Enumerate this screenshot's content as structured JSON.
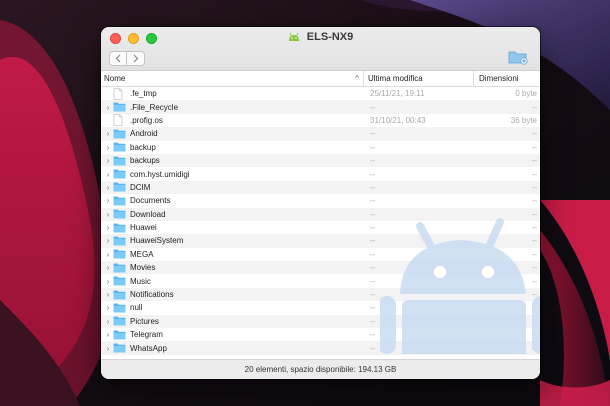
{
  "window": {
    "title": "ELS-NX9",
    "title_icon": "android-icon"
  },
  "toolbar": {
    "back_icon": "chevron-left-icon",
    "forward_icon": "chevron-right-icon",
    "new_folder_icon": "new-folder-icon"
  },
  "columns": {
    "name": "Nome",
    "modified": "Ultima modifica",
    "size": "Dimensioni"
  },
  "files": [
    {
      "name": ".fe_tmp",
      "type": "file",
      "modified": "25/11/21, 19:11",
      "size": "0 byte"
    },
    {
      "name": ".File_Recycle",
      "type": "folder",
      "modified": "--",
      "size": "--"
    },
    {
      "name": ".profig.os",
      "type": "file",
      "modified": "31/10/21, 00:43",
      "size": "36 byte"
    },
    {
      "name": "Android",
      "type": "folder",
      "modified": "--",
      "size": "--"
    },
    {
      "name": "backup",
      "type": "folder",
      "modified": "--",
      "size": "--"
    },
    {
      "name": "backups",
      "type": "folder",
      "modified": "--",
      "size": "--"
    },
    {
      "name": "com.hyst.umidigi",
      "type": "folder",
      "modified": "--",
      "size": "--"
    },
    {
      "name": "DCIM",
      "type": "folder",
      "modified": "--",
      "size": "--"
    },
    {
      "name": "Documents",
      "type": "folder",
      "modified": "--",
      "size": "--"
    },
    {
      "name": "Download",
      "type": "folder",
      "modified": "--",
      "size": "--"
    },
    {
      "name": "Huawei",
      "type": "folder",
      "modified": "--",
      "size": "--"
    },
    {
      "name": "HuaweiSystem",
      "type": "folder",
      "modified": "--",
      "size": "--"
    },
    {
      "name": "MEGA",
      "type": "folder",
      "modified": "--",
      "size": "--"
    },
    {
      "name": "Movies",
      "type": "folder",
      "modified": "--",
      "size": "--"
    },
    {
      "name": "Music",
      "type": "folder",
      "modified": "--",
      "size": "--"
    },
    {
      "name": "Notifications",
      "type": "folder",
      "modified": "--",
      "size": "--"
    },
    {
      "name": "null",
      "type": "folder",
      "modified": "--",
      "size": "--"
    },
    {
      "name": "Pictures",
      "type": "folder",
      "modified": "--",
      "size": "--"
    },
    {
      "name": "Telegram",
      "type": "folder",
      "modified": "--",
      "size": "--"
    },
    {
      "name": "WhatsApp",
      "type": "folder",
      "modified": "--",
      "size": "--"
    }
  ],
  "status": {
    "text": "20 elementi, spazio disponibile: 194.13 GB"
  },
  "colors": {
    "folder": "#5bb7f0",
    "watermark": "#c9dcf3"
  }
}
